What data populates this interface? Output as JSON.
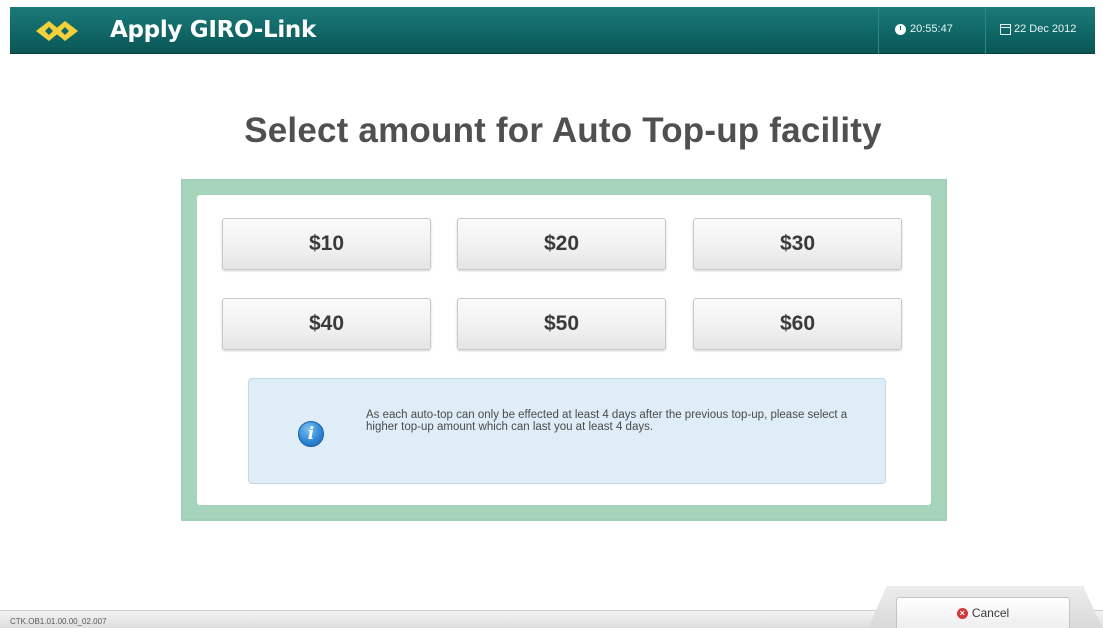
{
  "header": {
    "title": "Apply GIRO-Link",
    "logo_icon": "transitlink-logo-icon",
    "time": "20:55:47",
    "date": "22 Dec 2012"
  },
  "page": {
    "title": "Select amount for Auto Top-up facility"
  },
  "amounts": [
    "$10",
    "$20",
    "$30",
    "$40",
    "$50",
    "$60"
  ],
  "info": {
    "icon": "info-icon",
    "text": "As each auto-top can only be effected at least 4 days after the previous top-up, please select a higher top-up amount which can last you at least 4 days."
  },
  "footer": {
    "terminal_code": "CTK.OB1.01.00.00_02.007",
    "cancel_label": "Cancel"
  },
  "colors": {
    "header": "#0f6766",
    "panel_border": "#a5d4bb",
    "info_bg": "#deedf7"
  }
}
